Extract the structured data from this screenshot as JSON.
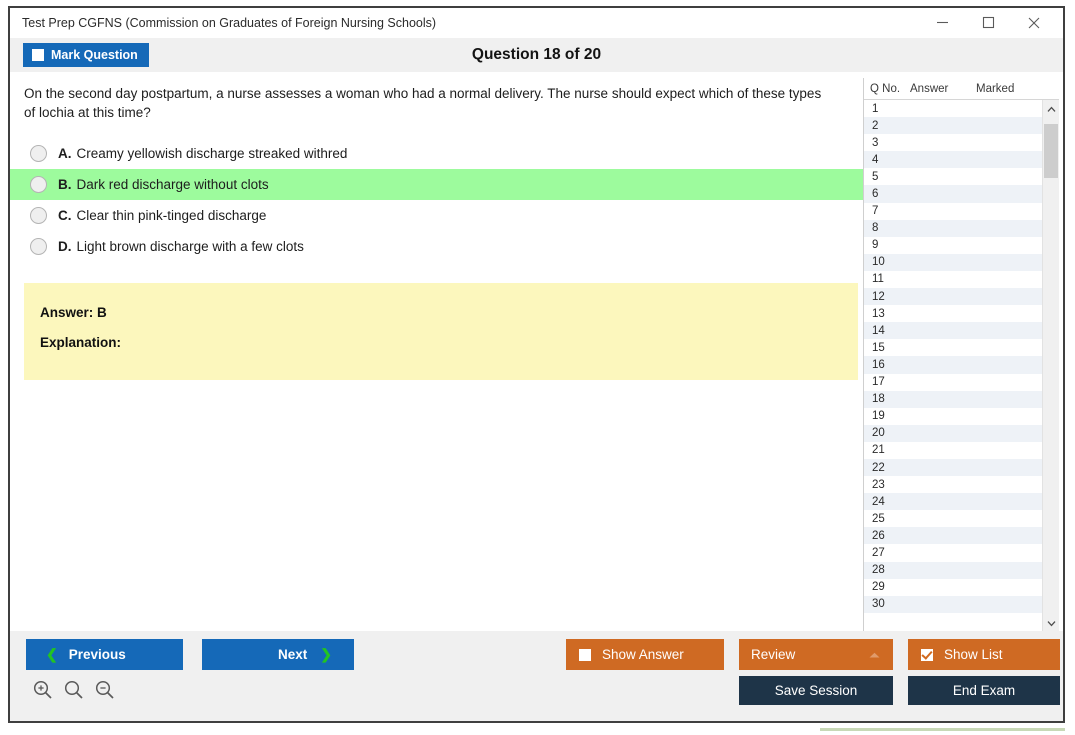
{
  "window": {
    "title": "Test Prep CGFNS (Commission on Graduates of Foreign Nursing Schools)",
    "controls": {
      "minimize": "minimize-icon",
      "maximize": "maximize-icon",
      "close": "close-icon"
    }
  },
  "header": {
    "mark_question_label": "Mark Question",
    "mark_question_checked": false,
    "question_title": "Question 18 of 20"
  },
  "question": {
    "text": "On the second day postpartum, a nurse assesses a woman who had a normal delivery. The nurse should expect which of these types of lochia at this time?",
    "options": [
      {
        "letter": "A.",
        "text": "Creamy yellowish discharge streaked withred",
        "selected": false,
        "highlighted": false
      },
      {
        "letter": "B.",
        "text": "Dark red discharge without clots",
        "selected": false,
        "highlighted": true
      },
      {
        "letter": "C.",
        "text": "Clear thin pink-tinged discharge",
        "selected": false,
        "highlighted": false
      },
      {
        "letter": "D.",
        "text": "Light brown discharge with a few clots",
        "selected": false,
        "highlighted": false
      }
    ]
  },
  "answer_panel": {
    "answer_line": "Answer: B",
    "explanation_line": "Explanation:",
    "background_color": "#fcf7bd"
  },
  "question_list": {
    "columns": [
      "Q No.",
      "Answer",
      "Marked"
    ],
    "rows": [
      {
        "no": "1",
        "answer": "",
        "marked": ""
      },
      {
        "no": "2",
        "answer": "",
        "marked": ""
      },
      {
        "no": "3",
        "answer": "",
        "marked": ""
      },
      {
        "no": "4",
        "answer": "",
        "marked": ""
      },
      {
        "no": "5",
        "answer": "",
        "marked": ""
      },
      {
        "no": "6",
        "answer": "",
        "marked": ""
      },
      {
        "no": "7",
        "answer": "",
        "marked": ""
      },
      {
        "no": "8",
        "answer": "",
        "marked": ""
      },
      {
        "no": "9",
        "answer": "",
        "marked": ""
      },
      {
        "no": "10",
        "answer": "",
        "marked": ""
      },
      {
        "no": "11",
        "answer": "",
        "marked": ""
      },
      {
        "no": "12",
        "answer": "",
        "marked": ""
      },
      {
        "no": "13",
        "answer": "",
        "marked": ""
      },
      {
        "no": "14",
        "answer": "",
        "marked": ""
      },
      {
        "no": "15",
        "answer": "",
        "marked": ""
      },
      {
        "no": "16",
        "answer": "",
        "marked": ""
      },
      {
        "no": "17",
        "answer": "",
        "marked": ""
      },
      {
        "no": "18",
        "answer": "",
        "marked": ""
      },
      {
        "no": "19",
        "answer": "",
        "marked": ""
      },
      {
        "no": "20",
        "answer": "",
        "marked": ""
      },
      {
        "no": "21",
        "answer": "",
        "marked": ""
      },
      {
        "no": "22",
        "answer": "",
        "marked": ""
      },
      {
        "no": "23",
        "answer": "",
        "marked": ""
      },
      {
        "no": "24",
        "answer": "",
        "marked": ""
      },
      {
        "no": "25",
        "answer": "",
        "marked": ""
      },
      {
        "no": "26",
        "answer": "",
        "marked": ""
      },
      {
        "no": "27",
        "answer": "",
        "marked": ""
      },
      {
        "no": "28",
        "answer": "",
        "marked": ""
      },
      {
        "no": "29",
        "answer": "",
        "marked": ""
      },
      {
        "no": "30",
        "answer": "",
        "marked": ""
      }
    ],
    "scrollbar": {
      "up_arrow": "chevron-up-icon",
      "down_arrow": "chevron-down-icon"
    }
  },
  "footer": {
    "previous_label": "Previous",
    "next_label": "Next",
    "show_answer_label": "Show Answer",
    "show_answer_checked": false,
    "review_label": "Review",
    "review_expanded": true,
    "show_list_label": "Show List",
    "show_list_checked": true,
    "save_session_label": "Save Session",
    "end_exam_label": "End Exam",
    "zoom_icons": [
      "zoom-in-icon",
      "zoom-reset-icon",
      "zoom-out-icon"
    ]
  },
  "colors": {
    "primary_blue": "#1569b8",
    "accent_orange": "#cf6a23",
    "navy": "#1e3448",
    "highlight_green": "#9dfb9d",
    "panel_yellow": "#fcf7bd"
  }
}
